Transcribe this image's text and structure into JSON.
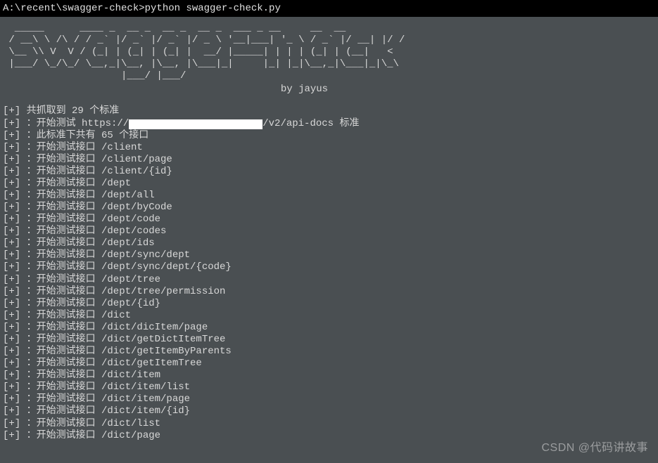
{
  "prompt": "A:\\recent\\swagger-check>python swagger-check.py",
  "ascii_art": "  _____      ____ _  __ _  __ _  __ _  ___ _ __     __  __\n / __\\ \\ /\\ / / _` |/ _` |/ _` |/ _ \\ '__|___| '_ \\ / _` |/ __| |/ /\n \\__ \\\\ V  V / (_| | (_| | (_| |  __/ |_____| | | | (_| | (__|   < \n |___/ \\_/\\_/ \\__,_|\\__, |\\__, |\\___|_|     |_| |_|\\__,_|\\___|_|\\_\\\n                    |___/ |___/",
  "byline": "                                               by jayus",
  "summary": {
    "prefix": "[+]",
    "grab_text": "共抓取到 29 个标准",
    "test_start_before": "：开始测试 https://",
    "test_start_after": "/v2/api-docs 标准",
    "iface_count_text": "：此标准下共有 65 个接口",
    "test_iface_text": "：开始测试接口 "
  },
  "endpoints": [
    "/client",
    "/client/page",
    "/client/{id}",
    "/dept",
    "/dept/all",
    "/dept/byCode",
    "/dept/code",
    "/dept/codes",
    "/dept/ids",
    "/dept/sync/dept",
    "/dept/sync/dept/{code}",
    "/dept/tree",
    "/dept/tree/permission",
    "/dept/{id}",
    "/dict",
    "/dict/dicItem/page",
    "/dict/getDictItemTree",
    "/dict/getItemByParents",
    "/dict/getItemTree",
    "/dict/item",
    "/dict/item/list",
    "/dict/item/page",
    "/dict/item/{id}",
    "/dict/list",
    "/dict/page"
  ],
  "watermark": "CSDN @代码讲故事"
}
